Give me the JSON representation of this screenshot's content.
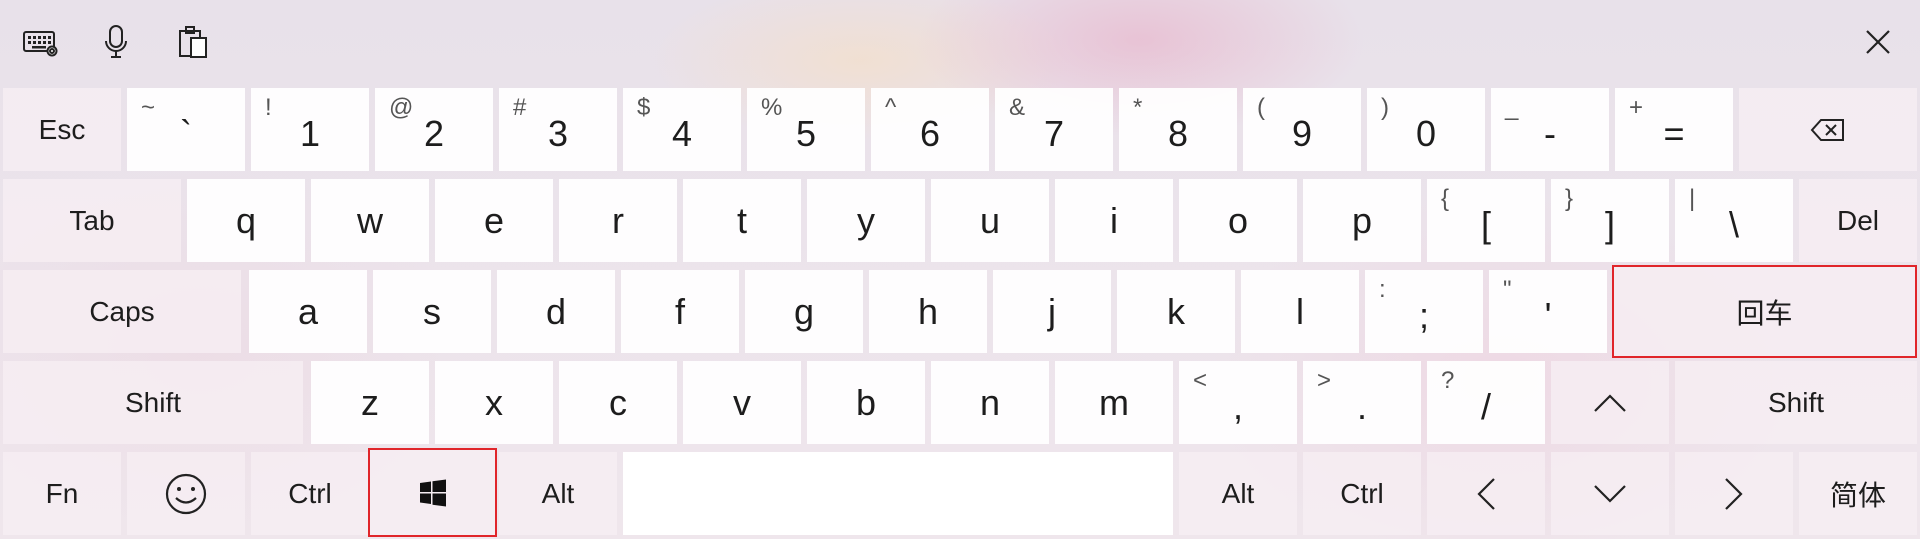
{
  "toolbar": {
    "keyboard_settings_icon": "keyboard-icon",
    "voice_typing_icon": "microphone-icon",
    "clipboard_icon": "clipboard-icon",
    "close_icon": "close-icon"
  },
  "row1": {
    "esc": "Esc",
    "grave": {
      "sec": "~",
      "pri": "`"
    },
    "k1": {
      "sec": "!",
      "pri": "1"
    },
    "k2": {
      "sec": "@",
      "pri": "2"
    },
    "k3": {
      "sec": "#",
      "pri": "3"
    },
    "k4": {
      "sec": "$",
      "pri": "4"
    },
    "k5": {
      "sec": "%",
      "pri": "5"
    },
    "k6": {
      "sec": "^",
      "pri": "6"
    },
    "k7": {
      "sec": "&",
      "pri": "7"
    },
    "k8": {
      "sec": "*",
      "pri": "8"
    },
    "k9": {
      "sec": "(",
      "pri": "9"
    },
    "k0": {
      "sec": ")",
      "pri": "0"
    },
    "minus": {
      "sec": "_",
      "pri": "-"
    },
    "equals": {
      "sec": "+",
      "pri": "="
    },
    "backspace_icon": "backspace-icon"
  },
  "row2": {
    "tab": "Tab",
    "letters": [
      "q",
      "w",
      "e",
      "r",
      "t",
      "y",
      "u",
      "i",
      "o",
      "p"
    ],
    "lbracket": {
      "sec": "{",
      "pri": "["
    },
    "rbracket": {
      "sec": "}",
      "pri": "]"
    },
    "backslash": {
      "sec": "|",
      "pri": "\\"
    },
    "del": "Del"
  },
  "row3": {
    "caps": "Caps",
    "letters": [
      "a",
      "s",
      "d",
      "f",
      "g",
      "h",
      "j",
      "k",
      "l"
    ],
    "semicolon": {
      "sec": ":",
      "pri": ";"
    },
    "quote": {
      "sec": "\"",
      "pri": "'"
    },
    "enter": "回车"
  },
  "row4": {
    "shift_left": "Shift",
    "letters": [
      "z",
      "x",
      "c",
      "v",
      "b",
      "n",
      "m"
    ],
    "comma": {
      "sec": "<",
      "pri": ","
    },
    "period": {
      "sec": ">",
      "pri": "."
    },
    "slash": {
      "sec": "?",
      "pri": "/"
    },
    "up_icon": "chevron-up-icon",
    "shift_right": "Shift"
  },
  "row5": {
    "fn": "Fn",
    "emoji_icon": "emoji-icon",
    "ctrl_left": "Ctrl",
    "windows_icon": "windows-logo-icon",
    "alt_left": "Alt",
    "alt_right": "Alt",
    "ctrl_right": "Ctrl",
    "left_icon": "chevron-left-icon",
    "down_icon": "chevron-down-icon",
    "right_icon": "chevron-right-icon",
    "lang": "简体"
  },
  "colors": {
    "highlight": "#e0252a"
  }
}
